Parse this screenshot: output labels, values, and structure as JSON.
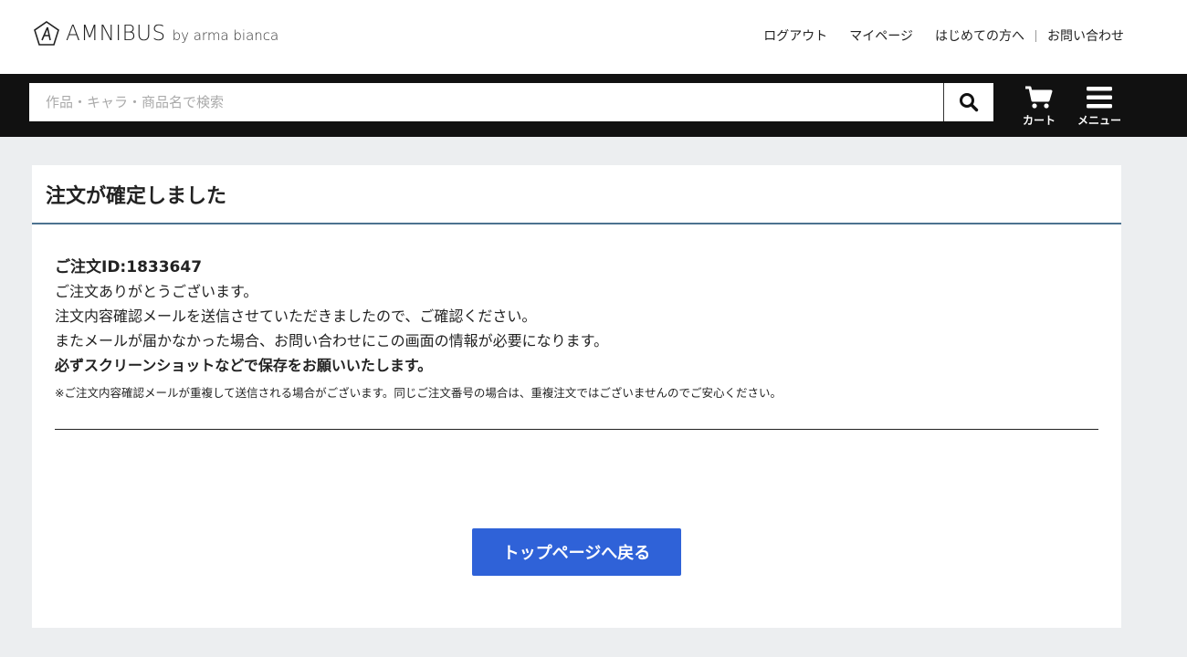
{
  "brand": {
    "name": "AMNIBUS",
    "sub": "by arma bianca"
  },
  "topnav": {
    "logout": "ログアウト",
    "mypage": "マイページ",
    "beginners": "はじめての方へ",
    "contact": "お問い合わせ"
  },
  "search": {
    "placeholder": "作品・キャラ・商品名で検索"
  },
  "actions": {
    "cart_label": "カート",
    "menu_label": "メニュー"
  },
  "confirmation": {
    "title": "注文が確定しました",
    "order_id": "ご注文ID:1833647",
    "line1": "ご注文ありがとうございます。",
    "line2": "注文内容確認メールを送信させていただきましたので、ご確認ください。",
    "line3": "またメールが届かなかった場合、お問い合わせにこの画面の情報が必要になります。",
    "line4": "必ずスクリーンショットなどで保存をお願いいたします。",
    "note": "※ご注文内容確認メールが重複して送信される場合がございます。同じご注文番号の場合は、重複注文ではございませんのでご安心ください。",
    "back_button": "トップページへ戻る"
  },
  "colors": {
    "header_bar": "#111111",
    "accent_button": "#2f62d8",
    "title_underline": "#4c7290",
    "page_background": "#eceef0"
  },
  "icons": {
    "logo": "amnibus-logo-icon",
    "search": "search-icon",
    "cart": "cart-icon",
    "menu": "hamburger-menu-icon"
  }
}
